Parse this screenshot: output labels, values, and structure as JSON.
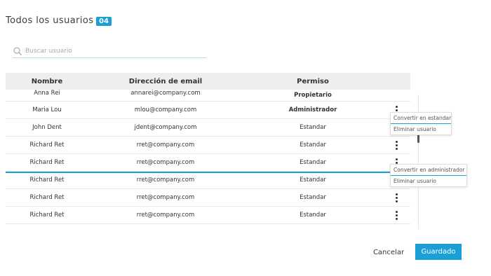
{
  "header": {
    "title": "Todos los usuarios",
    "count": "04"
  },
  "search": {
    "placeholder": "Buscar usuario"
  },
  "table": {
    "columns": [
      "Nombre",
      "Dirección de email",
      "Permiso"
    ],
    "rows": [
      {
        "name": "Anna Rei",
        "email": "annarei@company.com",
        "permission": "Propietario"
      },
      {
        "name": "Maria Lou",
        "email": "mlou@company.com",
        "permission": "Administrador"
      },
      {
        "name": "John Dent",
        "email": "jdent@company.com",
        "permission": "Estandar"
      },
      {
        "name": "Richard Ret",
        "email": "rret@company.com",
        "permission": "Estandar"
      },
      {
        "name": "Richard Ret",
        "email": "rret@company.com",
        "permission": "Estandar"
      },
      {
        "name": "Richard Ret",
        "email": "rret@company.com",
        "permission": "Estandar"
      },
      {
        "name": "Richard Ret",
        "email": "rret@company.com",
        "permission": "Estandar"
      },
      {
        "name": "Richard Ret",
        "email": "rret@company.com",
        "permission": "Estandar"
      }
    ]
  },
  "menus": {
    "admin_menu": [
      "Convertir en estandar",
      "Eliminar usuario"
    ],
    "standard_menu": [
      "Convertir en administrador",
      "Eliminar usuario"
    ]
  },
  "footer": {
    "cancel_label": "Cancelar",
    "save_label": "Guardado"
  },
  "colors": {
    "accent": "#1a9fd6",
    "header_bg": "#eeeeee",
    "text": "#333333"
  }
}
